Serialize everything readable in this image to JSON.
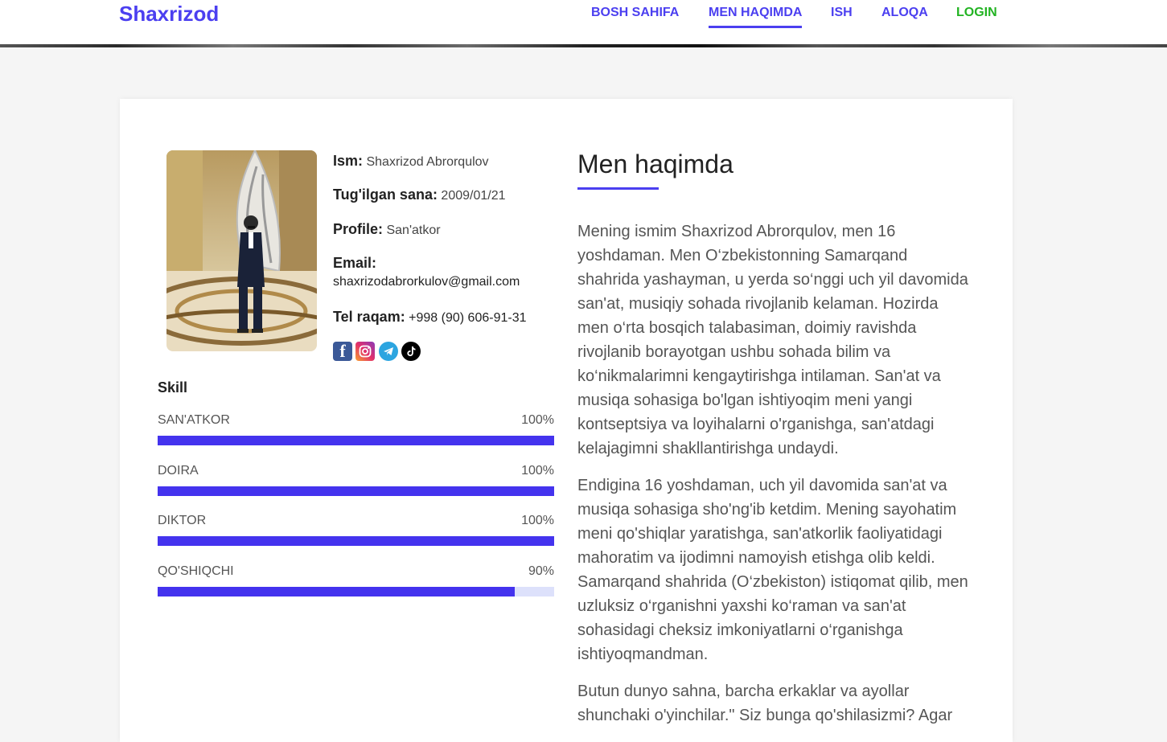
{
  "brand": "Shaxrizod",
  "nav": {
    "home": "BOSH SAHIFA",
    "about": "MEN HAQIMDA",
    "work": "ISH",
    "contact": "ALOQA",
    "login": "LOGIN"
  },
  "profile": {
    "name_label": "Ism:",
    "name": "Shaxrizod Abrorqulov",
    "birth_label": "Tug'ilgan sana:",
    "birth": "2009/01/21",
    "profile_label": "Profile:",
    "profile": "San'atkor",
    "email_label": "Email:",
    "email": "shaxrizodabrorkulov@gmail.com",
    "phone_label": "Tel raqam:",
    "phone": "+998 (90) 606-91-31"
  },
  "socials": [
    "facebook-icon",
    "instagram-icon",
    "telegram-icon",
    "tiktok-icon"
  ],
  "skills": {
    "title": "Skill",
    "items": [
      {
        "name": "SAN'ATKOR",
        "percent_label": "100%",
        "level": 1.0
      },
      {
        "name": "DOIRA",
        "percent_label": "100%",
        "level": 1.0
      },
      {
        "name": "DIKTOR",
        "percent_label": "100%",
        "level": 1.0
      },
      {
        "name": "QO'SHIQCHI",
        "percent_label": "90%",
        "level": 0.9
      }
    ]
  },
  "about": {
    "title": "Men haqimda",
    "p1": "Mening ismim Shaxrizod Abrorqulov, men 16 yoshdaman. Men O‘zbekistonning Samarqand shahrida yashayman, u yerda so‘nggi uch yil davomida san'at, musiqiy sohada rivojlanib kelaman. Hozirda men o‘rta bosqich talabasiman, doimiy ravishda rivojlanib borayotgan ushbu sohada bilim va ko‘nikmalarimni kengaytirishga intilaman. San'at va musiqa sohasiga bo'lgan ishtiyoqim meni yangi kontseptsiya va loyihalarni o'rganishga, san'atdagi kelajagimni shakllantirishga undaydi.",
    "p2": "Endigina 16 yoshdaman, uch yil davomida san'at va musiqa sohasiga sho'ng'ib ketdim. Mening sayohatim meni qo'shiqlar yaratishga, san'atkorlik faoliyatidagi mahoratim va ijodimni namoyish etishga olib keldi. Samarqand shahrida (O‘zbekiston) istiqomat qilib, men uzluksiz o‘rganishni yaxshi ko‘raman va san'at sohasidagi cheksiz imkoniyatlarni o‘rganishga ishtiyoqmandman.",
    "p3": "Butun dunyo sahna, barcha erkaklar va ayollar shunchaki o'yinchilar.\" Siz bunga qo'shilasizmi? Agar"
  },
  "colors": {
    "accent": "#4b3ff0",
    "login": "#22b322",
    "bar_fill": "#4433ee",
    "bar_track": "#dde1fb",
    "page_bg": "#f5f5f5"
  }
}
